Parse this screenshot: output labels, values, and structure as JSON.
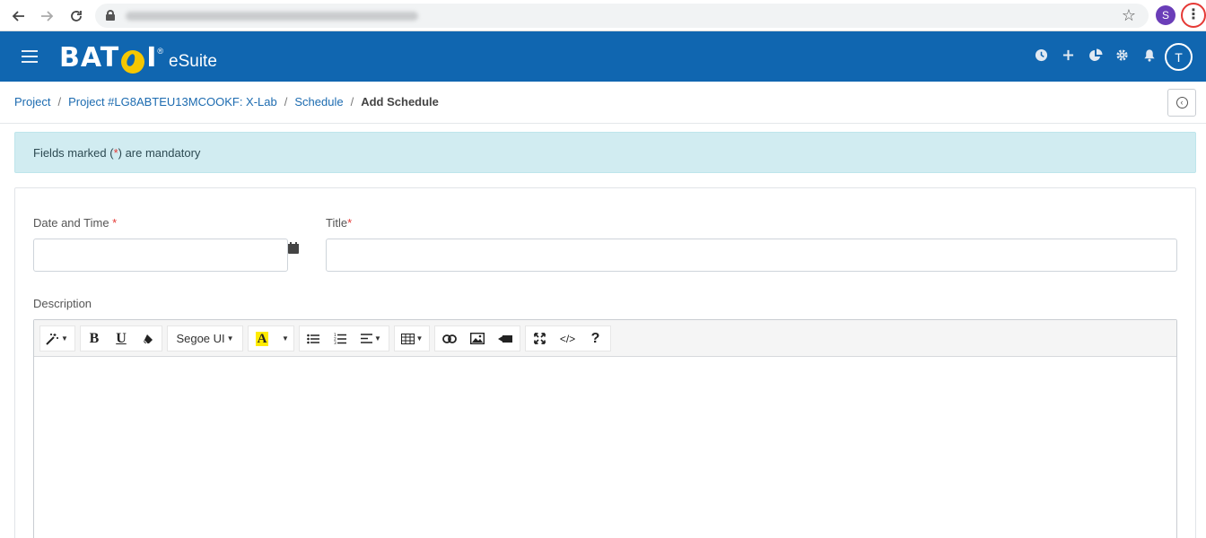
{
  "browser": {
    "back_icon": "arrow-left-icon",
    "forward_icon": "arrow-right-icon",
    "reload_icon": "reload-icon",
    "profile_initial": "S",
    "profile_color": "#6a3db8",
    "menu_highlight_color": "#e53935"
  },
  "app": {
    "brand": "BAT",
    "brand_end": "I",
    "brand_suffix": "eSuite",
    "header_color": "#1066b0",
    "user_initial": "T",
    "header_icons": [
      "clock-icon",
      "plus-icon",
      "pie-chart-icon",
      "gear-icon",
      "bell-icon"
    ]
  },
  "breadcrumb": {
    "items": [
      "Project",
      "Project #LG8ABTEU13MCOOKF: X-Lab",
      "Schedule"
    ],
    "current": "Add Schedule"
  },
  "alert": {
    "prefix": "Fields marked (",
    "mark": "*",
    "suffix": ") are mandatory"
  },
  "form": {
    "date_label": "Date and Time ",
    "date_required": "*",
    "date_value": "",
    "title_label": "Title",
    "title_required": "*",
    "title_value": "",
    "description_label": "Description"
  },
  "editor": {
    "style_icon": "magic-wand-icon",
    "bold": "B",
    "underline": "U",
    "eraser_icon": "eraser-icon",
    "font_name": "Segoe UI",
    "color_letter": "A",
    "highlight_color": "#ffeb00",
    "unordered_list_icon": "unordered-list-icon",
    "ordered_list_icon": "ordered-list-icon",
    "align_icon": "align-icon",
    "table_icon": "table-icon",
    "link_icon": "link-icon",
    "image_icon": "image-icon",
    "video_icon": "video-icon",
    "fullscreen_icon": "fullscreen-icon",
    "code_view": "</>",
    "help": "?",
    "content": ""
  }
}
